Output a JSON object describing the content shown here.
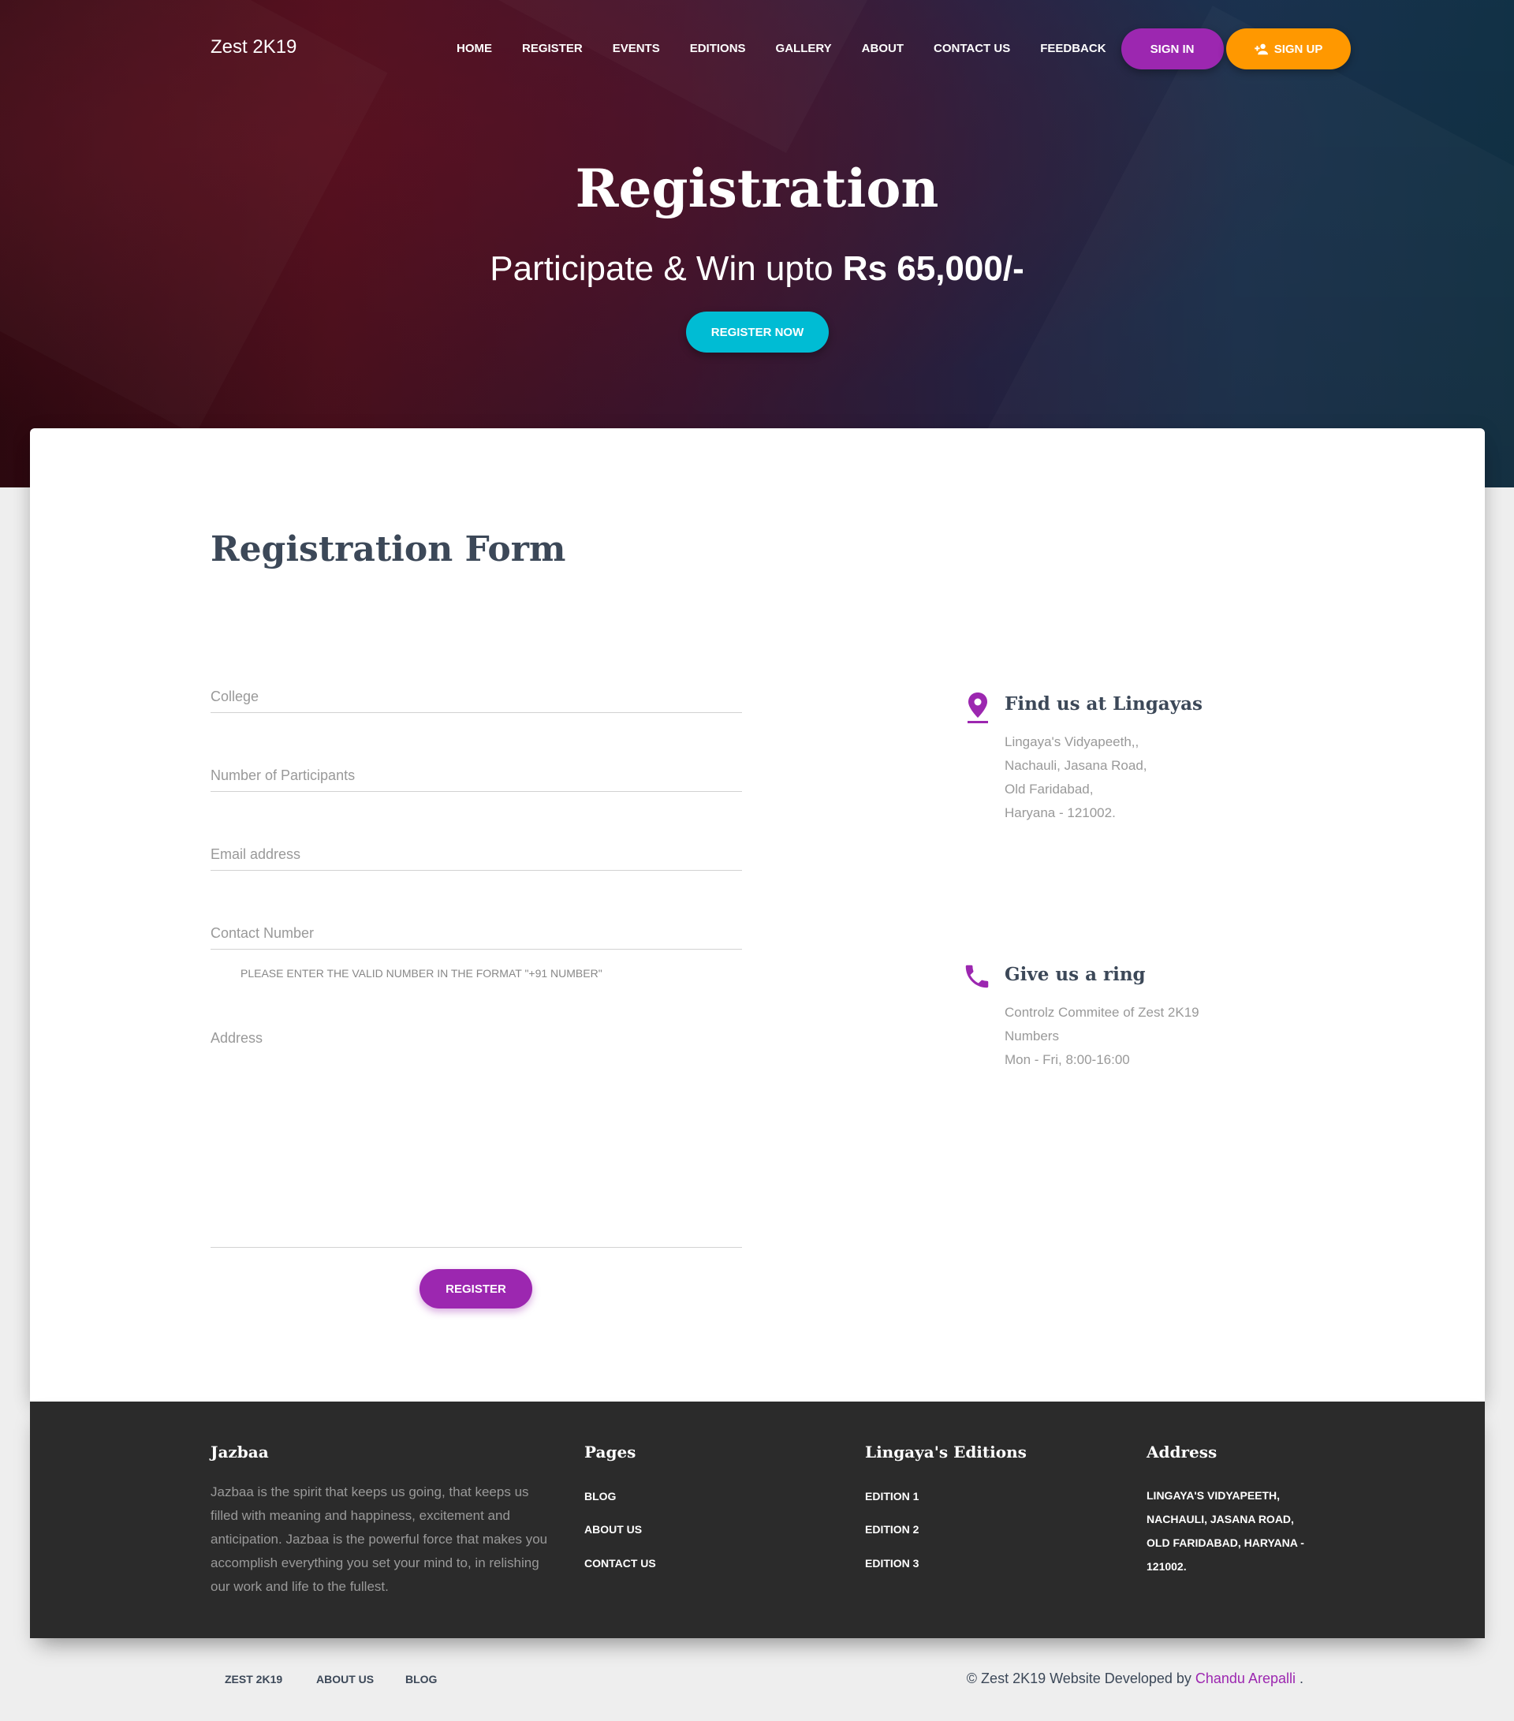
{
  "header": {
    "brand": "Zest 2K19",
    "nav": [
      "HOME",
      "REGISTER",
      "EVENTS",
      "EDITIONS",
      "GALLERY",
      "ABOUT",
      "CONTACT US",
      "FEEDBACK"
    ],
    "sign_in": "SIGN IN",
    "sign_up": "SIGN UP"
  },
  "hero": {
    "title": "Registration",
    "subtitle_prefix": "Participate & Win upto ",
    "subtitle_amount": "Rs 65,000/-",
    "cta": "REGISTER NOW"
  },
  "form": {
    "title": "Registration Form",
    "fields": {
      "college": "College",
      "participants": "Number of Participants",
      "email": "Email address",
      "contact": "Contact Number",
      "address": "Address"
    },
    "contact_helper": "PLEASE ENTER THE VALID NUMBER IN THE FORMAT \"+91 NUMBER\"",
    "submit": "REGISTER"
  },
  "info": {
    "location": {
      "title": "Find us at Lingayas",
      "lines": [
        "Lingaya's Vidyapeeth,,",
        "Nachauli, Jasana Road,",
        "Old Faridabad,",
        "Haryana - 121002."
      ]
    },
    "phone": {
      "title": "Give us a ring",
      "lines": [
        "Controlz Commitee of Zest 2K19",
        "Numbers",
        "Mon - Fri, 8:00-16:00"
      ]
    }
  },
  "footer": {
    "about": {
      "title": "Jazbaa",
      "lines": [
        "Jazbaa is the spirit that keeps us going, that keeps us",
        "filled with meaning and happiness, excitement and",
        "anticipation. Jazbaa is the powerful force that makes you",
        "accomplish everything you set your mind to, in relishing",
        "our work and life to the fullest."
      ]
    },
    "pages": {
      "title": "Pages",
      "links": [
        "BLOG",
        "ABOUT US",
        "CONTACT US"
      ]
    },
    "editions": {
      "title": "Lingaya's Editions",
      "links": [
        "EDITION 1",
        "EDITION 2",
        "EDITION 3"
      ]
    },
    "address": {
      "title": "Address",
      "lines": [
        "LINGAYA'S VIDYAPEETH,",
        "NACHAULI, JASANA ROAD,",
        "OLD FARIDABAD, HARYANA -",
        "121002."
      ]
    }
  },
  "bottom": {
    "links": [
      "ZEST 2K19",
      "ABOUT US",
      "BLOG"
    ],
    "copyright_prefix": "© Zest 2K19 Website Developed by ",
    "author": "Chandu Arepalli",
    "suffix": " ."
  },
  "colors": {
    "primary": "#9c27b0",
    "warning": "#ff9800",
    "info": "#00bcd4",
    "footer_bg": "#2b2b2b"
  }
}
